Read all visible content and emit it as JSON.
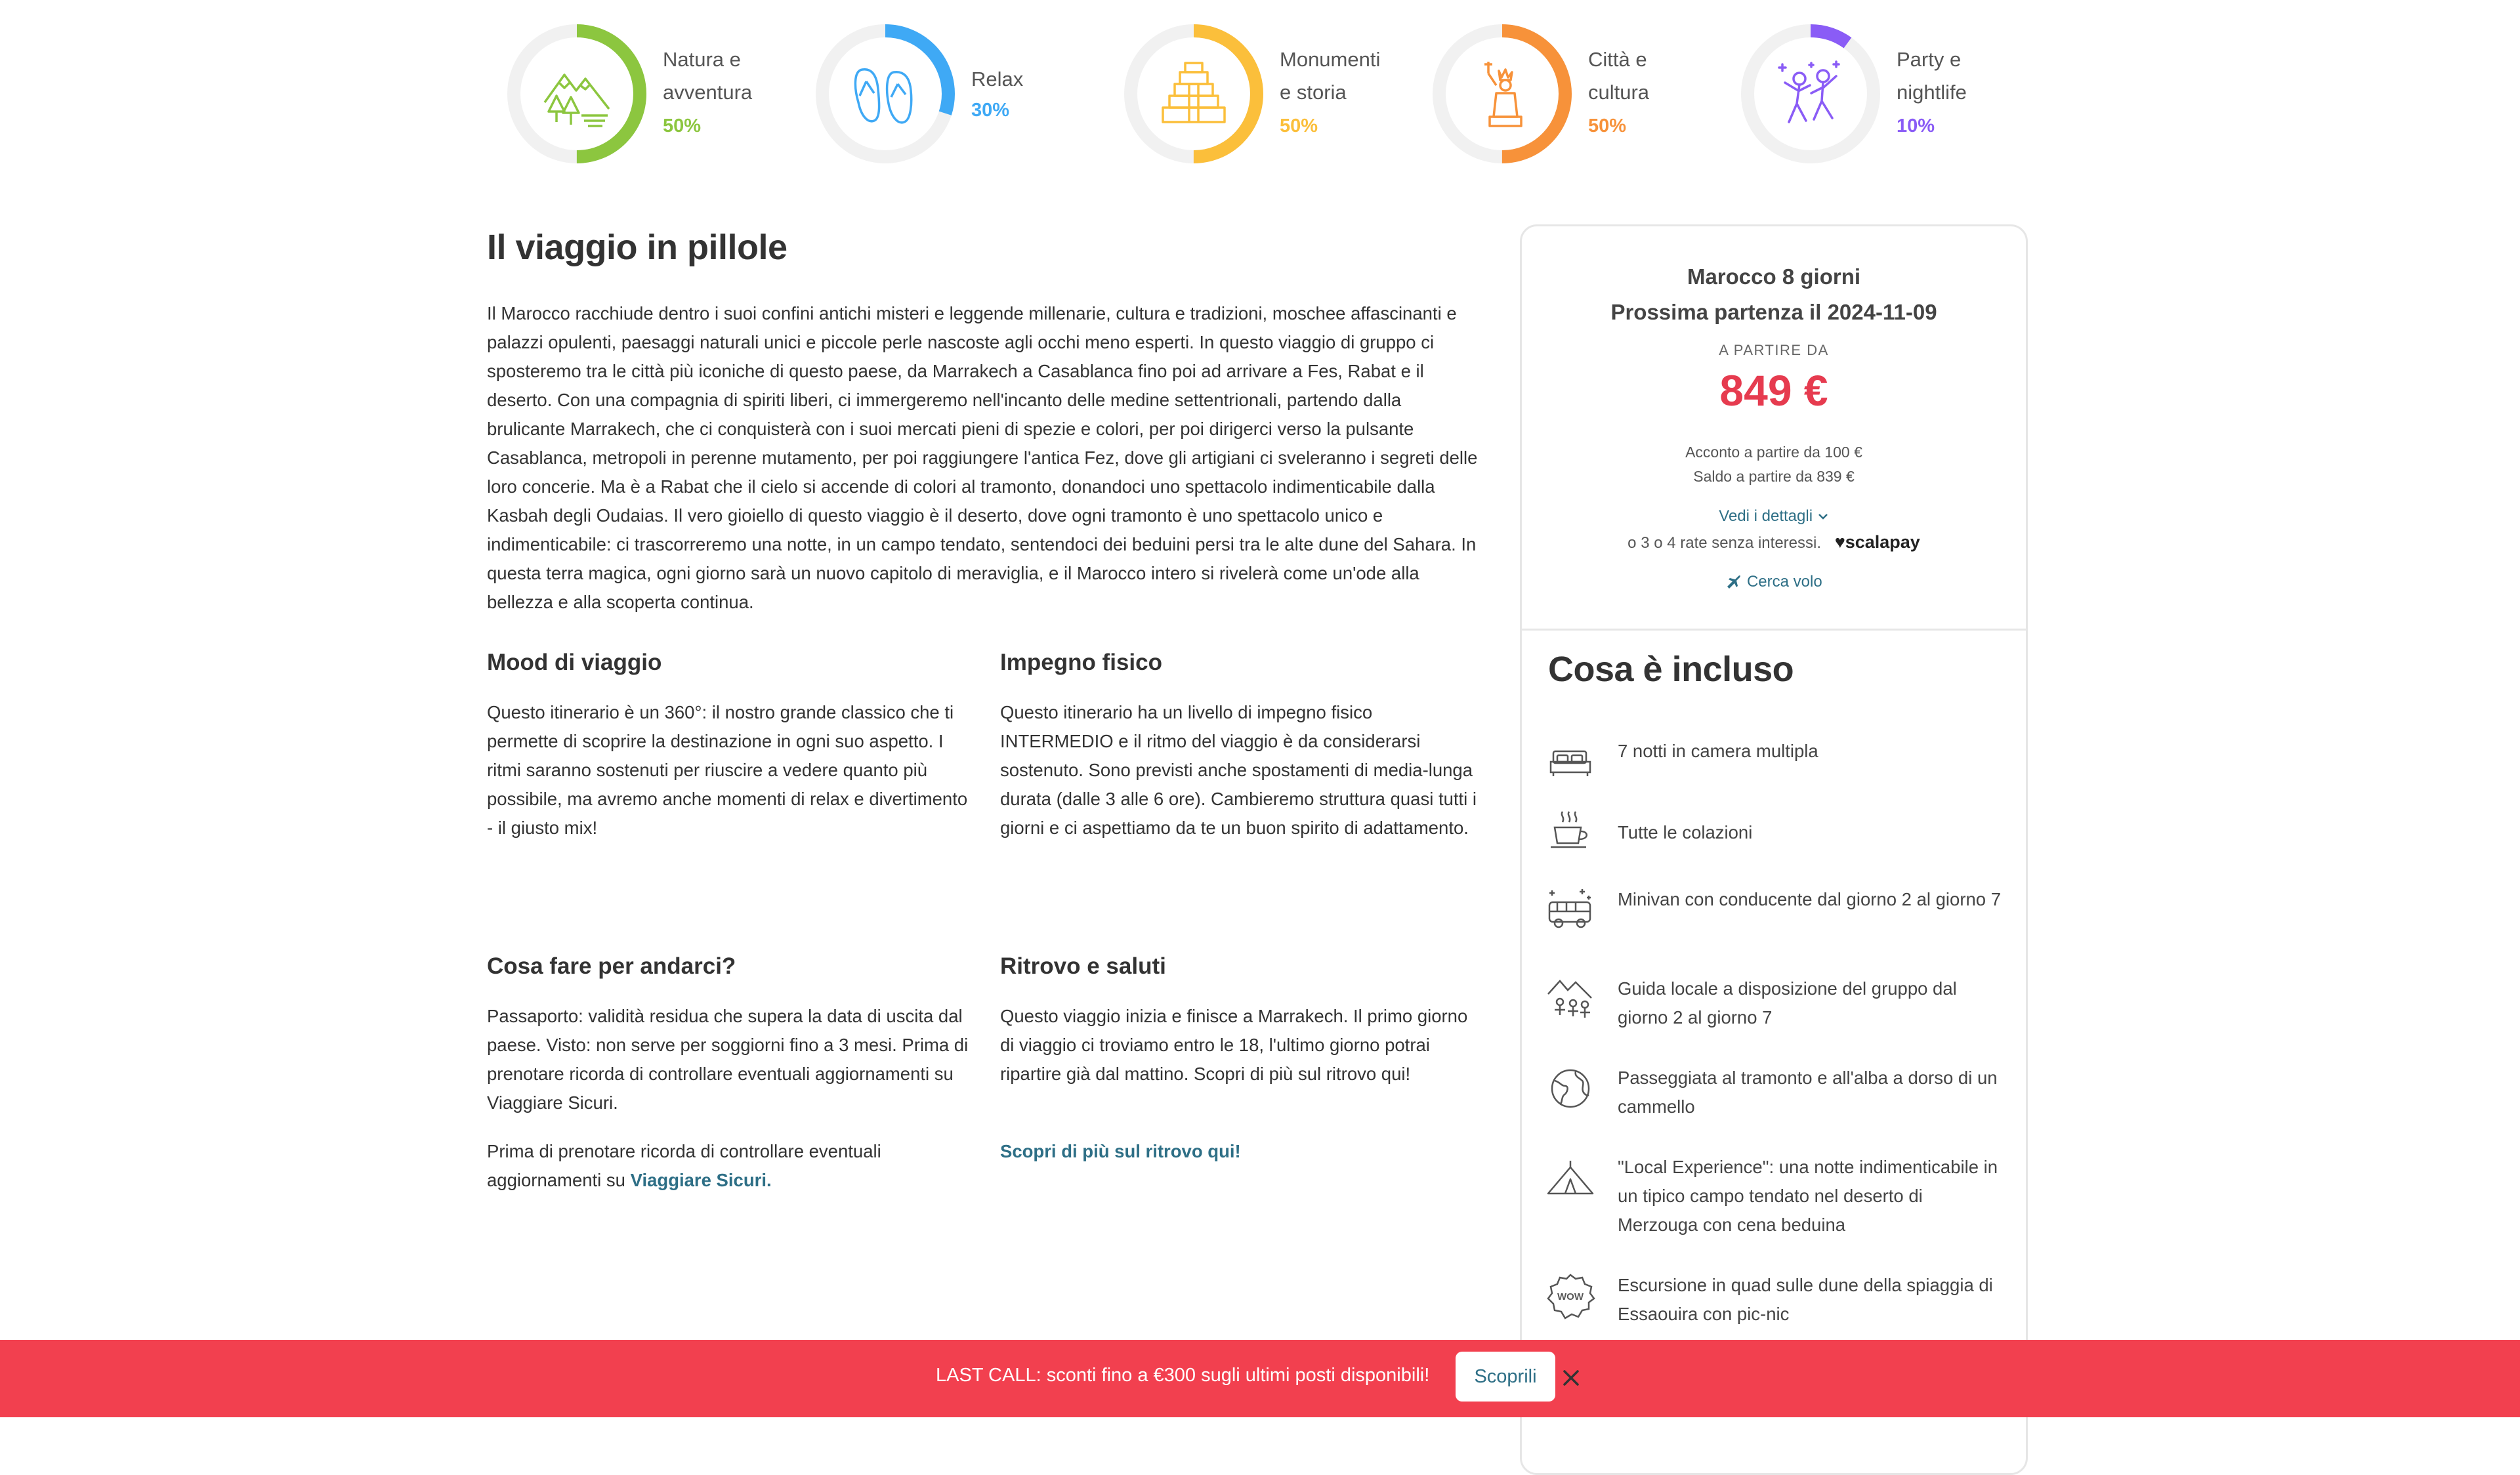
{
  "moods": [
    {
      "label_line1": "Natura e",
      "label_line2": "avventura",
      "percent": "50%",
      "value": 0.5,
      "color": "#8cc63f",
      "icon": "forest-mountain-icon"
    },
    {
      "label_line1": "Relax",
      "label_line2": "",
      "percent": "30%",
      "value": 0.3,
      "color": "#3fa9f5",
      "icon": "flip-flops-icon"
    },
    {
      "label_line1": "Monumenti",
      "label_line2": "e storia",
      "percent": "50%",
      "value": 0.5,
      "color": "#fbbf3b",
      "icon": "pyramid-icon"
    },
    {
      "label_line1": "Città e",
      "label_line2": "cultura",
      "percent": "50%",
      "value": 0.5,
      "color": "#f7923a",
      "icon": "statue-of-liberty-icon"
    },
    {
      "label_line1": "Party e",
      "label_line2": "nightlife",
      "percent": "10%",
      "value": 0.1,
      "color": "#8a5cf6",
      "icon": "dancing-people-icon"
    }
  ],
  "article": {
    "title": "Il viaggio in pillole",
    "intro": "Il Marocco racchiude dentro i suoi confini antichi misteri e leggende millenarie, cultura e tradizioni, moschee affascinanti e palazzi opulenti, paesaggi naturali unici e piccole perle nascoste agli occhi meno esperti. In questo viaggio di gruppo ci sposteremo tra le città più iconiche di questo paese, da Marrakech a Casablanca fino poi ad arrivare a Fes, Rabat e il deserto. Con una compagnia di spiriti liberi, ci immergeremo nell'incanto delle medine settentrionali, partendo dalla brulicante Marrakech, che ci conquisterà con i suoi mercati pieni di spezie e colori, per poi dirigerci verso la pulsante Casablanca, metropoli in perenne mutamento, per poi raggiungere l'antica Fez, dove gli artigiani ci sveleranno i segreti delle loro concerie. Ma è a Rabat che il cielo si accende di colori al tramonto, donandoci uno spettacolo indimenticabile dalla Kasbah degli Oudaias. Il vero gioiello di questo viaggio è il deserto, dove ogni tramonto è uno spettacolo unico e indimenticabile: ci trascorreremo una notte, in un campo tendato, sentendoci dei beduini persi tra le alte dune del Sahara. In questa terra magica, ogni giorno sarà un nuovo capitolo di meraviglia, e il Marocco intero si rivelerà come un'ode alla bellezza e alla scoperta continua.",
    "mood_title": "Mood di viaggio",
    "mood_text": "Questo itinerario è un 360°: il nostro grande classico che ti permette di scoprire la destinazione in ogni suo aspetto. I ritmi saranno sostenuti per riuscire a vedere quanto più possibile, ma avremo anche momenti di relax e divertimento - il giusto mix!",
    "effort_title": "Impegno fisico",
    "effort_text": "Questo itinerario ha un livello di impegno fisico INTERMEDIO e il ritmo del viaggio è da considerarsi sostenuto. Sono previsti anche spostamenti di media-lunga durata (dalle 3 alle 6 ore). Cambieremo struttura quasi tutti i giorni e ci aspettiamo da te un buon spirito di adattamento.",
    "todo_title": "Cosa fare per andarci?",
    "todo_text": "Passaporto: validità residua che supera la data di uscita dal paese. Visto: non serve per soggiorni fino a 3 mesi. Prima di prenotare ricorda di controllare eventuali aggiornamenti su Viaggiare Sicuri.",
    "todo_text2": "Prima di prenotare ricorda di controllare eventuali aggiornamenti su",
    "todo_link": "Viaggiare Sicuri.",
    "meet_title": "Ritrovo e saluti",
    "meet_text": "Questo viaggio inizia e finisce a Marrakech. Il primo giorno di viaggio ci troviamo entro le 18, l'ultimo giorno potrai ripartire già dal mattino. Scopri di più sul ritrovo qui!",
    "meet_link": "Scopri di più sul ritrovo qui!"
  },
  "card": {
    "trip_name": "Marocco 8 giorni",
    "next_departure": "Prossima partenza il 2024-11-09",
    "from_label": "A PARTIRE DA",
    "price": "849 €",
    "deposit": "Acconto a partire da 100 €",
    "balance": "Saldo a partire da 839 €",
    "details_link": "Vedi i dettagli",
    "installments": "o 3 o 4 rate senza interessi.",
    "scalapay": "♥scalapay",
    "flight_link": "Cerca volo",
    "included_title": "Cosa è incluso",
    "included": [
      {
        "icon": "bed-icon",
        "text": "7 notti in camera multipla"
      },
      {
        "icon": "coffee-cup-icon",
        "text": "Tutte le colazioni"
      },
      {
        "icon": "van-icon",
        "text": "Minivan con conducente dal giorno 2 al giorno 7"
      },
      {
        "icon": "guide-group-icon",
        "text": "Guida locale a disposizione del gruppo dal giorno 2 al giorno 7"
      },
      {
        "icon": "globe-icon",
        "text": "Passeggiata al tramonto e all'alba a dorso di un cammello"
      },
      {
        "icon": "tent-icon",
        "text": "\"Local Experience\": una notte indimenticabile in un tipico campo tendato nel deserto di Merzouga con cena beduina"
      },
      {
        "icon": "wow-badge-icon",
        "text": "Escursione in quad sulle dune della spiaggia di Essaouira con pic-nic"
      }
    ]
  },
  "banner": {
    "text": "LAST CALL: sconti fino a €300 sugli ultimi posti disponibili!",
    "button": "Scoprili",
    "color": "#f2404f"
  }
}
